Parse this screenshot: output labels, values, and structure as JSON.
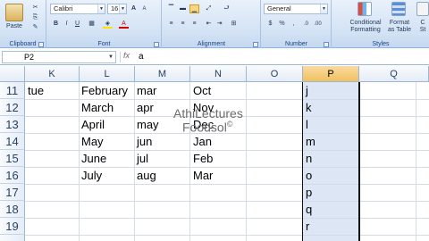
{
  "ribbon": {
    "clipboard": {
      "paste_label": "Paste",
      "group_label": "Clipboard"
    },
    "font": {
      "family": "Calibri",
      "size": "16",
      "group_label": "Font",
      "bold": "B",
      "italic": "I",
      "underline": "U",
      "grow": "A",
      "shrink": "A",
      "color_a": "A"
    },
    "alignment": {
      "group_label": "Alignment"
    },
    "number": {
      "format": "General",
      "currency": "$",
      "percent": "%",
      "comma": ",",
      "group_label": "Number"
    },
    "styles": {
      "cond_format": "Conditional\nFormatting",
      "format_table": "Format\nas Table",
      "cell_styles": "C\nSt",
      "group_label": "Styles"
    }
  },
  "formula_bar": {
    "name_box": "P2",
    "fx": "fx",
    "value": "a"
  },
  "grid": {
    "columns": [
      "K",
      "L",
      "M",
      "N",
      "O",
      "P",
      "Q"
    ],
    "rows": [
      "11",
      "12",
      "13",
      "14",
      "15",
      "16",
      "17",
      "18",
      "19",
      ""
    ],
    "cells": {
      "K": [
        "tue",
        "",
        "",
        "",
        "",
        "",
        "",
        "",
        "",
        ""
      ],
      "L": [
        "February",
        "March",
        "April",
        "May",
        "June",
        "July",
        "",
        "",
        "",
        ""
      ],
      "M": [
        "mar",
        "apr",
        "may",
        "jun",
        "jul",
        "aug",
        "",
        "",
        "",
        ""
      ],
      "N": [
        "Oct",
        "Nov",
        "Dec",
        "Jan",
        "Feb",
        "Mar",
        "",
        "",
        "",
        ""
      ],
      "P": [
        "j",
        "k",
        "l",
        "m",
        "n",
        "o",
        "p",
        "q",
        "r",
        ""
      ]
    }
  },
  "watermark": {
    "line1": "AthiLectures",
    "line2": "Foodsol",
    "mark": "©"
  }
}
